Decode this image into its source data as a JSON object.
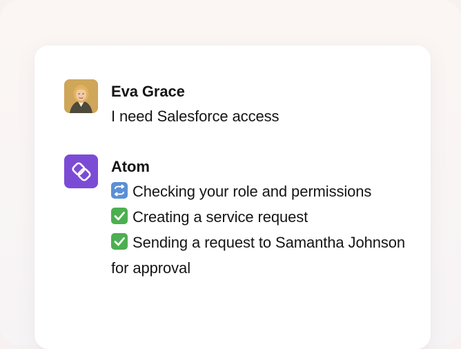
{
  "conversation": {
    "user_message": {
      "sender": "Eva Grace",
      "text": "I need Salesforce access",
      "avatar_icon": "user-photo-avatar"
    },
    "bot_message": {
      "sender": "Atom",
      "avatar_icon": "atom-logo-icon",
      "avatar_color": "#7c4bd6",
      "steps": [
        {
          "icon": "repeat-emoji-icon",
          "text": "Checking your role and permissions"
        },
        {
          "icon": "check-mark-emoji-icon",
          "text": "Creating a service request"
        },
        {
          "icon": "check-mark-emoji-icon",
          "text": "Sending a request to Samantha Johnson for approval"
        }
      ]
    }
  }
}
